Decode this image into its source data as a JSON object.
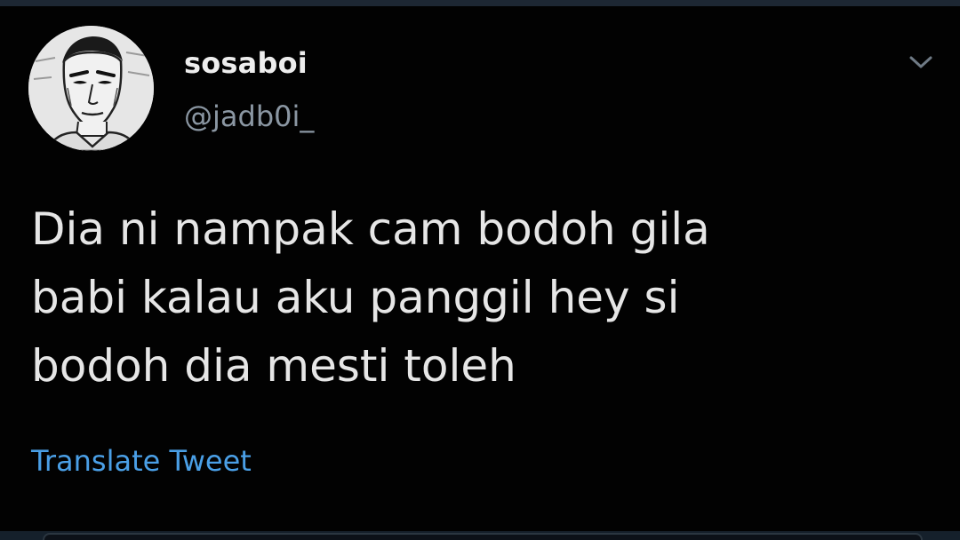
{
  "theme": {
    "background": "#020202",
    "text_primary": "#e6e6e6",
    "text_secondary": "#8b97a3",
    "link": "#4a9fe6"
  },
  "tweet": {
    "author": {
      "display_name": "sosaboi",
      "handle": "@jadb0i_",
      "avatar_icon": "manga-portrait-avatar"
    },
    "menu_icon": "chevron-down-icon",
    "text_lines": [
      "Dia ni nampak cam bodoh gila",
      "babi kalau aku panggil hey si",
      "bodoh dia mesti toleh"
    ],
    "translate_label": "Translate Tweet"
  }
}
